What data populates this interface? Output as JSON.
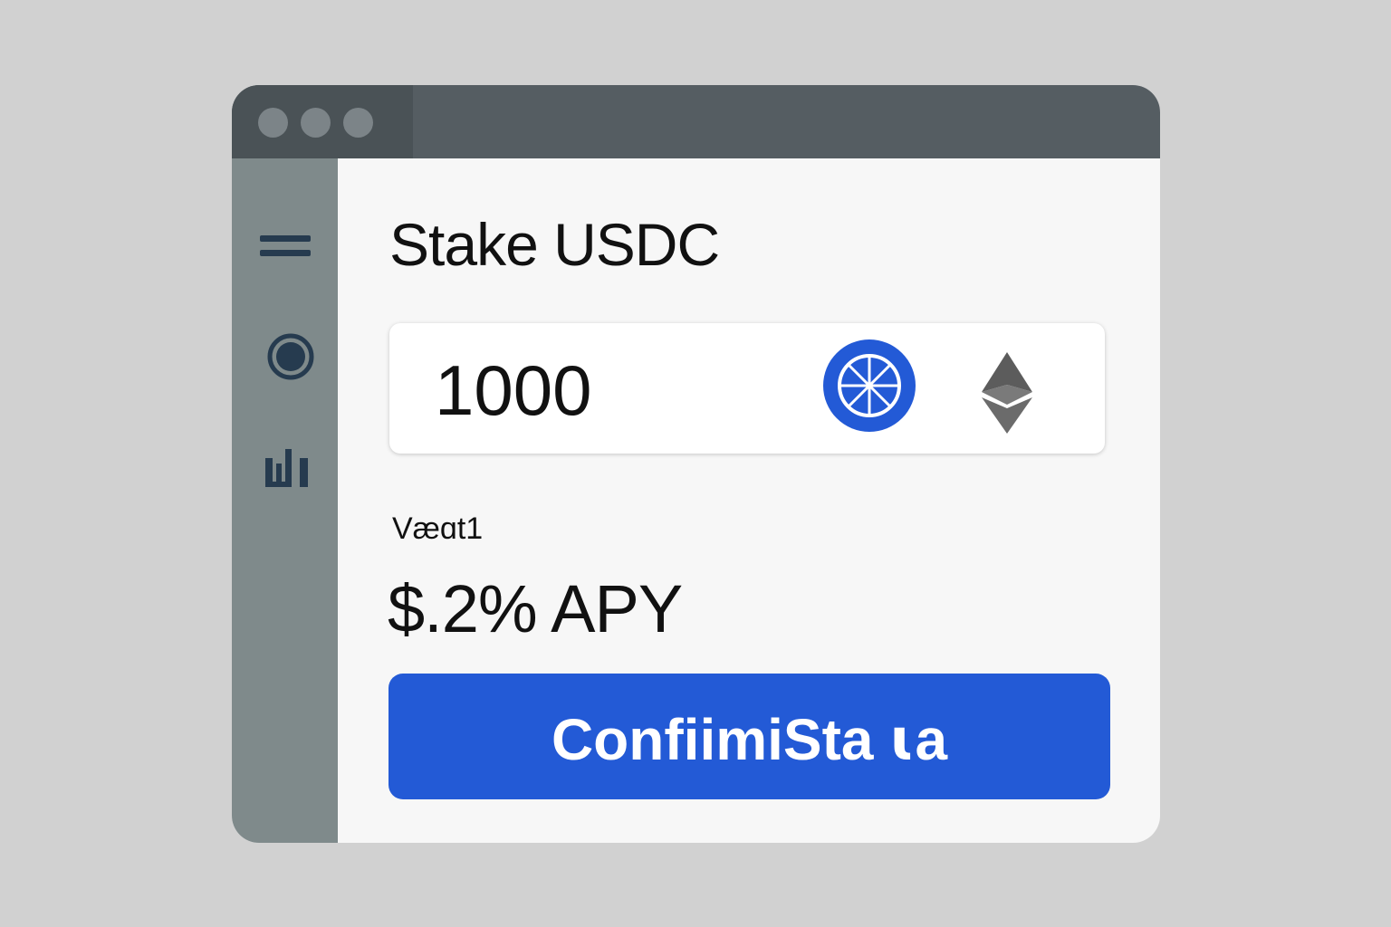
{
  "page": {
    "background": "#d1d1d1"
  },
  "window": {
    "titlebar_color": "#555d62",
    "controls": [
      "window-dot",
      "window-dot",
      "window-dot"
    ]
  },
  "sidebar": {
    "color": "#7f8a8b",
    "icon_color": "#263b4f",
    "items": [
      {
        "icon": "menu-icon"
      },
      {
        "icon": "circle-icon"
      },
      {
        "icon": "bar-chart-icon"
      }
    ]
  },
  "stake": {
    "title": "Stake USDC",
    "amount_value": "1000",
    "token_icon": "token-coin-icon",
    "network_icon": "ethereum-icon",
    "vault_label": "Væɑt1",
    "apy_text": "$.2% APY",
    "confirm_label": "ConfiimiSta ꙇa",
    "accent_color": "#235ad6"
  }
}
